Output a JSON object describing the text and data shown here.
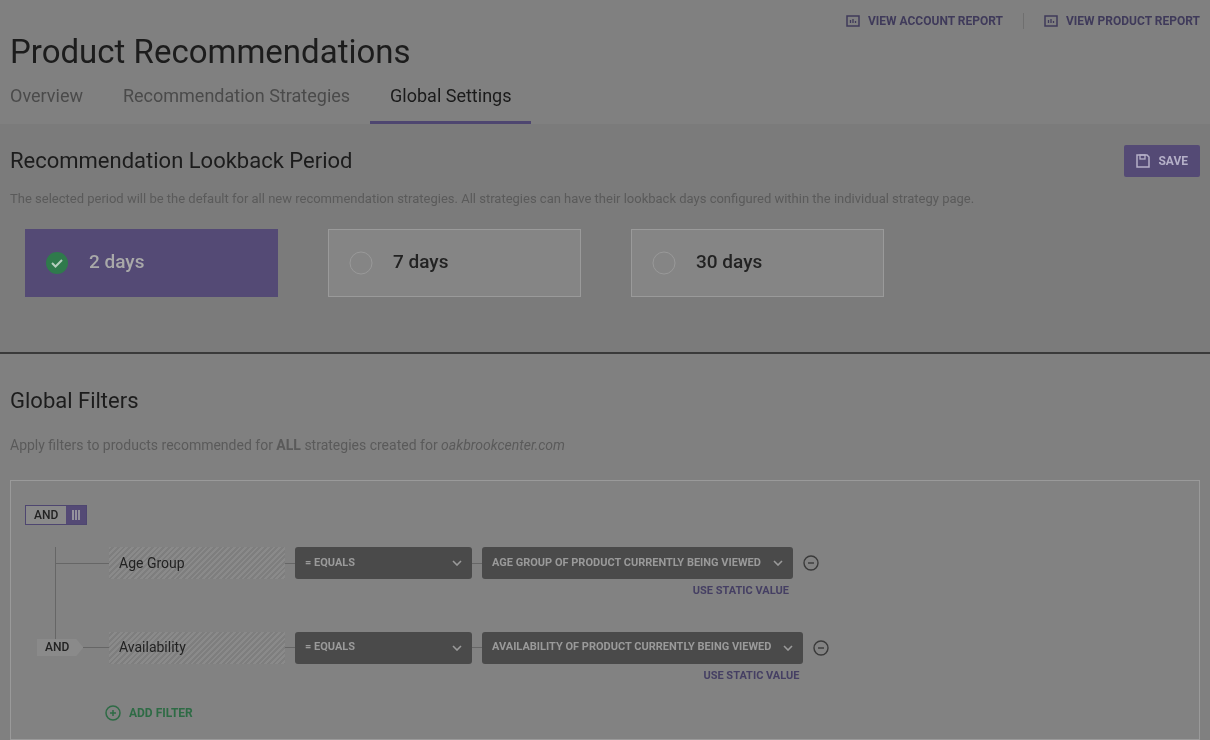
{
  "header_links": [
    "VIEW ACCOUNT REPORT",
    "VIEW PRODUCT REPORT"
  ],
  "title": "Product Recommendations",
  "tabs": [
    {
      "label": "Overview",
      "selected": false
    },
    {
      "label": "Recommendation Strategies",
      "selected": false
    },
    {
      "label": "Global Settings",
      "selected": true
    }
  ],
  "lookback": {
    "heading": "Recommendation Lookback Period",
    "save": "SAVE",
    "description": "The selected period will be the default for all new recommendation strategies. All strategies can have their lookback days configured within the individual strategy page.",
    "options": [
      {
        "label": "2 days",
        "selected": true
      },
      {
        "label": "7 days",
        "selected": false
      },
      {
        "label": "30 days",
        "selected": false
      }
    ]
  },
  "filters": {
    "heading": "Global Filters",
    "description": "Apply filters to products recommended for **ALL** strategies created for *oakbrookcenter.com*",
    "group_operator": "AND",
    "rows": [
      {
        "field": "Age Group",
        "operator": "= EQUALS",
        "value": "AGE GROUP OF PRODUCT CURRENTLY BEING VIEWED",
        "link": "USE STATIC VALUE"
      },
      {
        "connector": "AND",
        "field": "Availability",
        "operator": "= EQUALS",
        "value": "AVAILABILITY OF PRODUCT CURRENTLY BEING VIEWED",
        "link": "USE STATIC VALUE"
      }
    ],
    "add": "ADD FILTER"
  }
}
